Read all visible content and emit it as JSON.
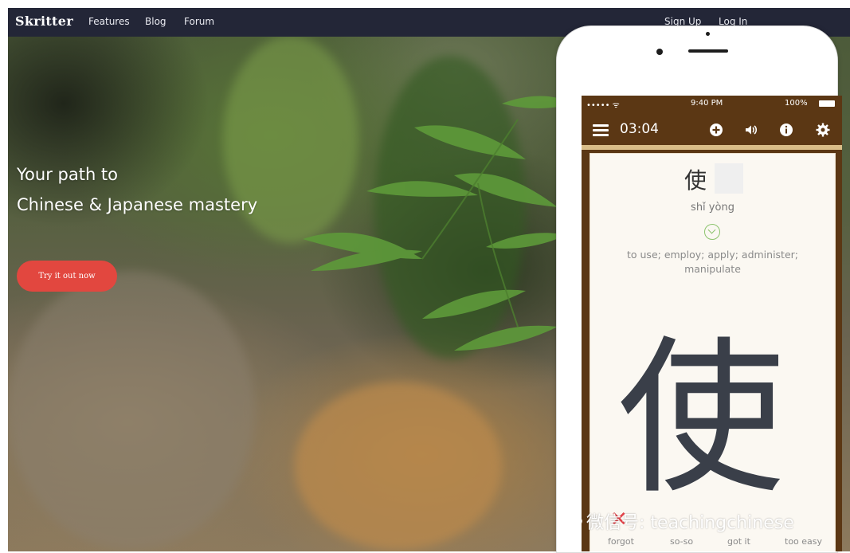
{
  "nav": {
    "logo": "Skritter",
    "links": [
      "Features",
      "Blog",
      "Forum"
    ],
    "signup": "Sign Up",
    "login": "Log In"
  },
  "hero": {
    "line1": "Your path to",
    "line2": "Chinese & Japanese mastery",
    "cta": "Try it out now"
  },
  "phone": {
    "status": {
      "carrier": "••••• ᯤ",
      "time": "9:40 PM",
      "battery": "100%"
    },
    "timer": "03:04",
    "toolbar_icons": [
      "add-icon",
      "volume-icon",
      "info-icon",
      "gear-icon"
    ],
    "card": {
      "character": "使",
      "pinyin": "shǐ  yòng",
      "definition": "to use; employ; apply; administer; manipulate",
      "big_character": "使",
      "answers": [
        "forgot",
        "so-so",
        "got it",
        "too easy"
      ]
    }
  },
  "watermark": "微信号: teachingchinese",
  "colors": {
    "nav_bg": "#232637",
    "cta": "#e2473f",
    "phone_header": "#5b3714",
    "card_bg": "#fbf8f2"
  }
}
